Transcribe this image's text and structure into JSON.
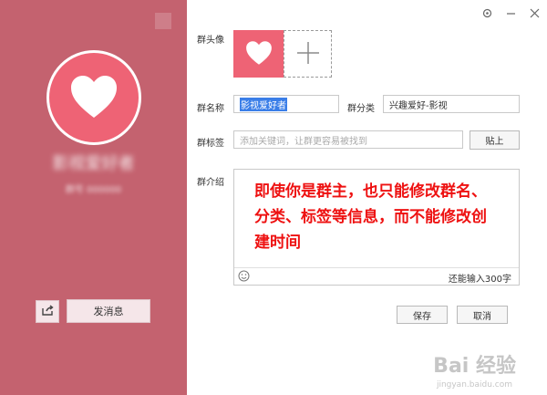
{
  "profile": {
    "name_blurred": "影视爱好者",
    "sub_blurred": "群号 000000",
    "send_message_label": "发消息"
  },
  "form": {
    "avatar_label": "群头像",
    "name_label": "群名称",
    "name_value": "影视爱好者",
    "category_label": "群分类",
    "category_value": "兴趣爱好-影视",
    "tags_label": "群标签",
    "tags_placeholder": "添加关键词，让群更容易被找到",
    "paste_button": "贴上",
    "intro_label": "群介绍",
    "intro_text": "即使你是群主，也只能修改群名、分类、标签等信息，而不能修改创建时间",
    "char_counter": "还能输入300字",
    "save_button": "保存",
    "cancel_button": "取消"
  },
  "watermark": {
    "brand": "Bai 经验",
    "url": "jingyan.baidu.com"
  },
  "colors": {
    "left_panel": "#c4626f",
    "avatar_pink": "#ee6375",
    "highlight_red": "#ee1111"
  },
  "icons": [
    "heart-icon",
    "share-icon",
    "plus-icon",
    "emoji-icon",
    "skin-icon",
    "minimize-icon",
    "close-icon"
  ]
}
